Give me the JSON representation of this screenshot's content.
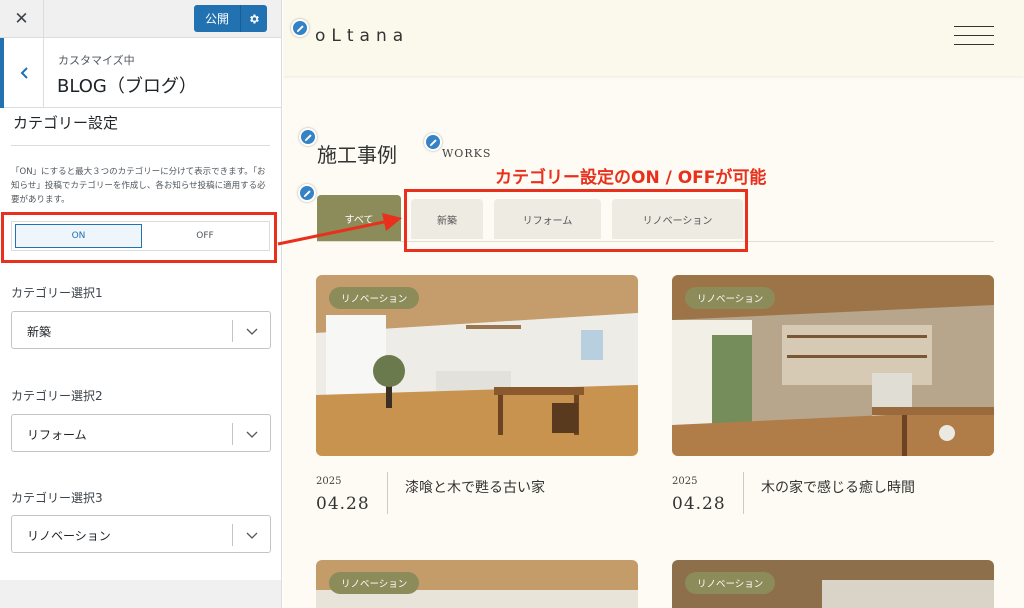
{
  "customizer": {
    "close_icon": "close-icon",
    "publish_label": "公開",
    "subtitle": "カスタマイズ中",
    "title": "BLOG（ブログ）",
    "section_title": "カテゴリー設定",
    "description": "「ON」にすると最大３つのカテゴリーに分けて表示できます。「お知らせ」投稿でカテゴリーを作成し、各お知らせ投稿に適用する必要があります。",
    "toggle": {
      "on": "ON",
      "off": "OFF",
      "selected": "ON"
    },
    "category_selects": [
      {
        "label": "カテゴリー選択1",
        "value": "新築"
      },
      {
        "label": "カテゴリー選択2",
        "value": "リフォーム"
      },
      {
        "label": "カテゴリー選択3",
        "value": "リノベーション"
      }
    ]
  },
  "preview": {
    "logo": "oLtana",
    "section_title": "施工事例",
    "section_title_en": "WORKS",
    "tabs": [
      {
        "label": "すべて",
        "active": true
      },
      {
        "label": "新築",
        "active": false
      },
      {
        "label": "リフォーム",
        "active": false
      },
      {
        "label": "リノベーション",
        "active": false
      }
    ],
    "posts": [
      {
        "badge": "リノベーション",
        "year": "2025",
        "date": "04.28",
        "title": "漆喰と木で甦る古い家"
      },
      {
        "badge": "リノベーション",
        "year": "2025",
        "date": "04.28",
        "title": "木の家で感じる癒し時間"
      },
      {
        "badge": "リノベーション"
      },
      {
        "badge": "リノベーション"
      }
    ]
  },
  "annotation": {
    "note": "カテゴリー設定のON / OFFが可能",
    "color": "#e8301c"
  },
  "colors": {
    "accent_blue": "#2271b1",
    "tab_active": "#8b8c5a",
    "preview_bg": "#fdfbf3"
  }
}
